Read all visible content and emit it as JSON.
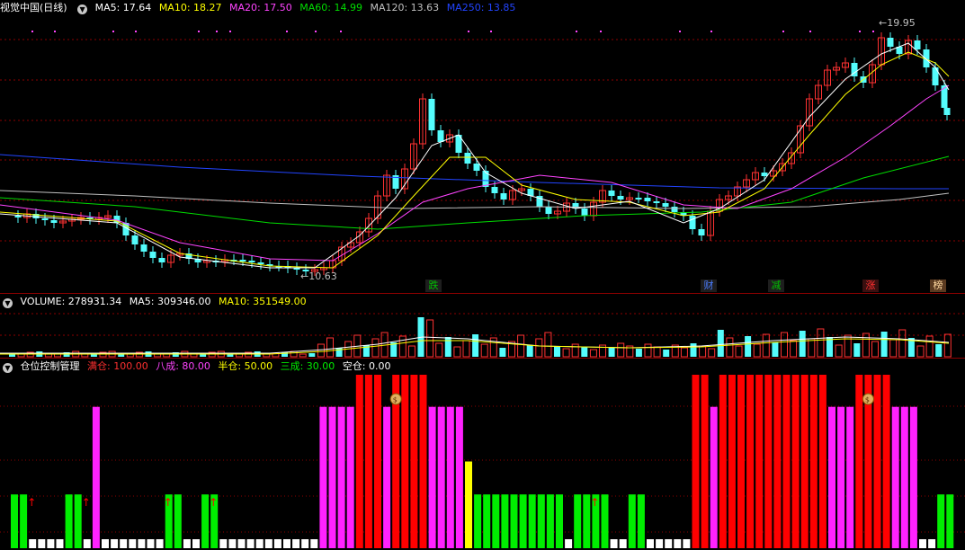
{
  "main_panel": {
    "title": "视觉中国(日线)",
    "ma_legend": [
      {
        "label": "MA5: 17.64",
        "color": "#ffffff"
      },
      {
        "label": "MA10: 18.27",
        "color": "#ffff00"
      },
      {
        "label": "MA20: 17.50",
        "color": "#ff44ff"
      },
      {
        "label": "MA60: 14.99",
        "color": "#00dd00"
      },
      {
        "label": "MA120: 13.63",
        "color": "#c0c0c0"
      },
      {
        "label": "MA250: 13.85",
        "color": "#2244ff"
      }
    ],
    "high_label": "19.95",
    "low_label": "10.63",
    "event_tags": [
      {
        "text": "跌",
        "color": "#00c000"
      },
      {
        "text": "财",
        "color": "#2a5cff"
      },
      {
        "text": "减",
        "color": "#00c000"
      },
      {
        "text": "涨",
        "color": "#dd0000"
      },
      {
        "text": "榜",
        "color": "#b8860b"
      }
    ]
  },
  "volume_panel": {
    "legend": [
      {
        "label": "VOLUME: 278931.34",
        "color": "#ffffff"
      },
      {
        "label": "MA5: 309346.00",
        "color": "#ffffff"
      },
      {
        "label": "MA10: 351549.00",
        "color": "#ffff00"
      }
    ]
  },
  "position_panel": {
    "title": "仓位控制管理",
    "legend": [
      {
        "label": "满仓: 100.00",
        "color": "#ff3030"
      },
      {
        "label": "八成: 80.00",
        "color": "#ff44ff"
      },
      {
        "label": "半仓: 50.00",
        "color": "#ffff00"
      },
      {
        "label": "三成: 30.00",
        "color": "#00ee00"
      },
      {
        "label": "空仓: 0.00",
        "color": "#ffffff"
      }
    ]
  },
  "colors": {
    "up_candle": "#ff3232",
    "down_candle": "#54fcfc",
    "grid": "#8b0000",
    "full": "#ff0000",
    "eighty": "#ff22ff",
    "half": "#ffff00",
    "thirty": "#00ee00",
    "empty": "#ffffff"
  },
  "chart_data": {
    "type": "bar",
    "title": "仓位控制管理",
    "levels": {
      "满仓": 100,
      "八成": 80,
      "半仓": 50,
      "三成": 30,
      "空仓": 0
    },
    "positions": [
      30,
      30,
      0,
      0,
      0,
      0,
      30,
      30,
      0,
      80,
      0,
      0,
      0,
      0,
      0,
      0,
      0,
      30,
      30,
      0,
      0,
      30,
      30,
      0,
      0,
      0,
      0,
      0,
      0,
      0,
      0,
      0,
      0,
      0,
      80,
      80,
      80,
      80,
      100,
      100,
      100,
      80,
      100,
      100,
      100,
      100,
      80,
      80,
      80,
      80,
      50,
      30,
      30,
      30,
      30,
      30,
      30,
      30,
      30,
      30,
      30,
      0,
      30,
      30,
      30,
      30,
      0,
      0,
      30,
      30,
      0,
      0,
      0,
      0,
      0,
      100,
      100,
      80,
      100,
      100,
      100,
      100,
      100,
      100,
      100,
      100,
      100,
      100,
      100,
      100,
      80,
      80,
      80,
      100,
      100,
      100,
      100,
      80,
      80,
      80,
      0,
      0,
      30,
      30
    ]
  }
}
